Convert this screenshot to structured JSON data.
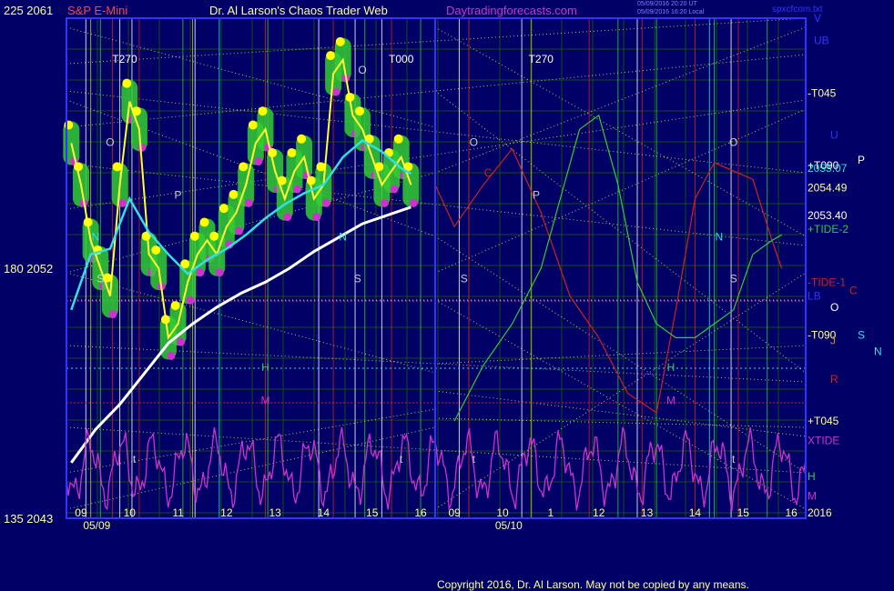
{
  "header": {
    "left_label": "225  2061",
    "instrument": "S&P E-Mini",
    "site_title": "Dr. Al Larson's Chaos Trader Web",
    "site_url": "Daytradingforecasts.com",
    "timestamp_1": "05/09/2016 20:20 UT",
    "timestamp_2": "05/09/2016 16:20 Local",
    "filename": "spxcfcom.txt"
  },
  "footer": {
    "copyright": "Copyright 2016, Dr. Al Larson. May not be copied by any means."
  },
  "colors": {
    "background": "#000066",
    "grid": "#1a4d1a",
    "frame": "#3333ff",
    "price_bar": "#33cc33",
    "price_line": "#ffff33",
    "ema_cyan": "#33e0e0",
    "ema_white": "#ffffff",
    "tide": "#cc2222",
    "xtide": "#cc33cc",
    "flux": "#ffff66",
    "text_left": "#ffff99"
  },
  "chart_data": {
    "type": "line",
    "title": "S&P E-Mini",
    "xlabel": "",
    "ylabel": "",
    "ylim": [
      2043,
      2061
    ],
    "y_ticks": [
      {
        "label": "225  2061",
        "value": 2061
      },
      {
        "label": "180  2052",
        "value": 2052
      },
      {
        "label": "135  2043",
        "value": 2043
      }
    ],
    "date_labels": [
      {
        "text": "05/09",
        "x": 9.0
      },
      {
        "text": "05/10",
        "x": 33.8
      }
    ],
    "x_ticks": [
      {
        "label": "09",
        "x": 9.2
      },
      {
        "label": "10",
        "x": 10.2
      },
      {
        "label": "11",
        "x": 11.2
      },
      {
        "label": "12",
        "x": 12.2
      },
      {
        "label": "13",
        "x": 13.2
      },
      {
        "label": "14",
        "x": 14.2
      },
      {
        "label": "15",
        "x": 15.2
      },
      {
        "label": "16",
        "x": 16.2
      },
      {
        "label": "09",
        "x": 33.2
      },
      {
        "label": "10",
        "x": 34.2
      },
      {
        "label": "1",
        "x": 35.2
      },
      {
        "label": "12",
        "x": 36.2
      },
      {
        "label": "13",
        "x": 37.2
      },
      {
        "label": "14",
        "x": 38.2
      },
      {
        "label": "15",
        "x": 39.2
      },
      {
        "label": "16",
        "x": 40.2
      }
    ],
    "series": [
      {
        "name": "Price",
        "x": [
          9.0,
          9.2,
          9.4,
          9.6,
          9.8,
          10.0,
          10.2,
          10.4,
          10.6,
          10.8,
          11.0,
          11.2,
          11.4,
          11.6,
          11.8,
          12.0,
          12.2,
          12.4,
          12.6,
          12.8,
          13.0,
          13.2,
          13.4,
          13.6,
          13.8,
          14.0,
          14.2,
          14.4,
          14.6,
          14.8,
          15.0,
          15.2,
          15.4,
          15.6,
          15.8,
          16.0
        ],
        "y": [
          2056.5,
          2055.0,
          2053.0,
          2052.0,
          2051.0,
          2055.0,
          2058.0,
          2057.0,
          2052.5,
          2052.0,
          2049.5,
          2050.0,
          2051.5,
          2052.5,
          2053.0,
          2052.5,
          2053.5,
          2054.0,
          2055.0,
          2056.5,
          2057.0,
          2055.5,
          2054.5,
          2055.5,
          2056.0,
          2054.5,
          2055.0,
          2059.0,
          2059.5,
          2057.5,
          2057.0,
          2056.0,
          2055.0,
          2055.5,
          2056.0,
          2055.0
        ]
      },
      {
        "name": "",
        "x": [
          9.0,
          9.4,
          9.8,
          10.2,
          10.6,
          11.0,
          11.4,
          11.8,
          12.2,
          12.6,
          13.0,
          13.4,
          13.8,
          14.2,
          14.6,
          15.0,
          15.4,
          15.8,
          16.0
        ],
        "y": [
          2050.5,
          2052.5,
          2052.7,
          2054.5,
          2053.3,
          2052.5,
          2051.8,
          2052.3,
          2052.7,
          2053.2,
          2053.8,
          2054.3,
          2054.7,
          2055.0,
          2056.0,
          2056.6,
          2056.2,
          2055.6,
          2055.4
        ]
      },
      {
        "name": "",
        "x": [
          9.0,
          9.5,
          10.0,
          10.5,
          11.0,
          11.5,
          12.0,
          12.5,
          13.0,
          13.5,
          14.0,
          14.5,
          15.0,
          15.5,
          16.0
        ],
        "y": [
          2045.0,
          2046.2,
          2047.1,
          2048.2,
          2049.3,
          2050.0,
          2050.6,
          2051.1,
          2051.5,
          2052.0,
          2052.6,
          2053.1,
          2053.6,
          2053.9,
          2054.2
        ]
      },
      {
        "name": "TIDE",
        "x": [
          16.5,
          33.2,
          33.8,
          34.4,
          35.0,
          35.6,
          36.2,
          36.8,
          37.4,
          37.8,
          38.2,
          38.6,
          39.0,
          39.4,
          39.8,
          40.0
        ],
        "y": [
          2055.0,
          2053.5,
          2055.0,
          2056.3,
          2054.0,
          2051.0,
          2049.5,
          2047.5,
          2046.8,
          2050.5,
          2054.5,
          2055.8,
          2055.5,
          2055.2,
          2053.0,
          2052.0
        ]
      },
      {
        "name": "TIDE-2",
        "x": [
          33.2,
          33.8,
          34.4,
          35.0,
          35.4,
          35.8,
          36.2,
          36.6,
          37.0,
          37.4,
          37.8,
          38.2,
          38.6,
          39.0,
          39.4,
          39.8,
          40.0
        ],
        "y": [
          2046.5,
          2048.5,
          2050.0,
          2052.0,
          2054.5,
          2057.0,
          2057.5,
          2055.0,
          2051.5,
          2050.0,
          2049.5,
          2049.5,
          2050.0,
          2050.5,
          2052.5,
          2053.0,
          2053.2
        ]
      }
    ],
    "annotations": [
      {
        "text": "T270",
        "x": 10.1,
        "y": 2059.4
      },
      {
        "text": "T000",
        "x": 15.8,
        "y": 2059.4
      },
      {
        "text": "T270",
        "x": 35.0,
        "y": 2059.4
      },
      {
        "text": "O",
        "x": 9.8,
        "y": 2056.4
      },
      {
        "text": "O",
        "x": 15.0,
        "y": 2059.0
      },
      {
        "text": "O",
        "x": 33.6,
        "y": 2056.4
      },
      {
        "text": "O",
        "x": 39.0,
        "y": 2056.4
      },
      {
        "text": "C",
        "x": 33.9,
        "y": 2055.3
      },
      {
        "text": "P",
        "x": 11.2,
        "y": 2054.5
      },
      {
        "text": "P",
        "x": 34.9,
        "y": 2054.5
      },
      {
        "text": "N",
        "x": 9.5,
        "y": 2053.0
      },
      {
        "text": "N",
        "x": 14.6,
        "y": 2053.0
      },
      {
        "text": "N",
        "x": 38.7,
        "y": 2053.0
      },
      {
        "text": "S",
        "x": 9.6,
        "y": 2051.5
      },
      {
        "text": "S",
        "x": 14.9,
        "y": 2051.5
      },
      {
        "text": "S",
        "x": 33.4,
        "y": 2051.5
      },
      {
        "text": "S",
        "x": 39.0,
        "y": 2051.5
      },
      {
        "text": "H",
        "x": 13.0,
        "y": 2048.3
      },
      {
        "text": "H",
        "x": 37.7,
        "y": 2048.3
      },
      {
        "text": "M",
        "x": 13.0,
        "y": 2047.1
      },
      {
        "text": "M",
        "x": 37.7,
        "y": 2047.1
      },
      {
        "text": "t",
        "x": 10.3,
        "y": 2045.0
      },
      {
        "text": "t",
        "x": 15.8,
        "y": 2045.0
      },
      {
        "text": "t",
        "x": 33.6,
        "y": 2045.0
      },
      {
        "text": "t",
        "x": 39.0,
        "y": 2045.0
      }
    ],
    "right_labels": [
      {
        "text": "V",
        "y": 2061.0,
        "color": "#3333ff"
      },
      {
        "text": "UB",
        "y": 2060.2,
        "color": "#3333ff"
      },
      {
        "text": "-T045",
        "y": 2058.3,
        "color": "#ffff99"
      },
      {
        "text": "U",
        "y": 2056.8,
        "color": "#3333ff"
      },
      {
        "text": "+T090",
        "y": 2055.7,
        "color": "#ffffff"
      },
      {
        "text": "2055.07",
        "y": 2055.6,
        "color": "#33e0e0"
      },
      {
        "text": "P",
        "y": 2055.9,
        "color": "#ffffff"
      },
      {
        "text": "2054.49",
        "y": 2054.9,
        "color": "#ffff99"
      },
      {
        "text": "2053.40",
        "y": 2053.9,
        "color": "#ffffff"
      },
      {
        "text": "+TIDE-2",
        "y": 2053.4,
        "color": "#33cc33"
      },
      {
        "text": "-TIDE-1",
        "y": 2051.5,
        "color": "#cc2222"
      },
      {
        "text": "C",
        "y": 2051.2,
        "color": "#cc2222"
      },
      {
        "text": "LB",
        "y": 2051.0,
        "color": "#3333ff"
      },
      {
        "text": "O",
        "y": 2050.6,
        "color": "#ffffff"
      },
      {
        "text": "-T090",
        "y": 2049.6,
        "color": "#ffff99"
      },
      {
        "text": "J",
        "y": 2049.4,
        "color": "#cc9933"
      },
      {
        "text": "S",
        "y": 2049.6,
        "color": "#33e0e0"
      },
      {
        "text": "N",
        "y": 2049.0,
        "color": "#33e0e0"
      },
      {
        "text": "R",
        "y": 2048.0,
        "color": "#cc2222"
      },
      {
        "text": "+T045",
        "y": 2046.5,
        "color": "#ffff99"
      },
      {
        "text": "XTIDE",
        "y": 2045.8,
        "color": "#cc33cc"
      },
      {
        "text": "H",
        "y": 2044.5,
        "color": "#33cc33"
      },
      {
        "text": "M",
        "y": 2043.8,
        "color": "#cc33cc"
      },
      {
        "text": "2016",
        "y": 2043.2,
        "color": "#ffff99"
      }
    ]
  }
}
